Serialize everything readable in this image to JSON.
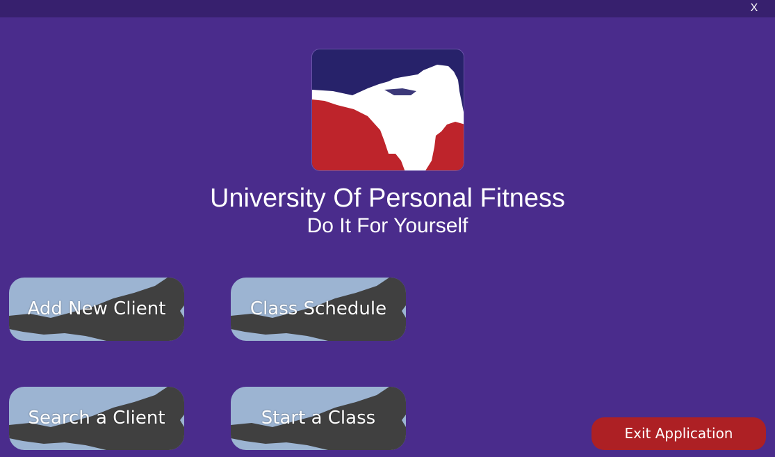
{
  "window": {
    "close_label": "X"
  },
  "logo": {
    "icon": "martial-arts-kick-logo",
    "colors": {
      "top": "#27226a",
      "bottom": "#be242b",
      "figure": "#ffffff"
    }
  },
  "header": {
    "title": "University Of Personal Fitness",
    "subtitle": "Do It For Yourself"
  },
  "menu": {
    "add_client": "Add New Client",
    "class_schedule": "Class Schedule",
    "search_client": "Search a Client",
    "start_class": "Start a Class"
  },
  "footer": {
    "exit_label": "Exit Application"
  },
  "colors": {
    "background": "#4a2c8c",
    "titlebar": "#37206e",
    "tile_light": "#9cb4d2",
    "tile_dark": "#404040",
    "exit_button": "#ad2024"
  }
}
